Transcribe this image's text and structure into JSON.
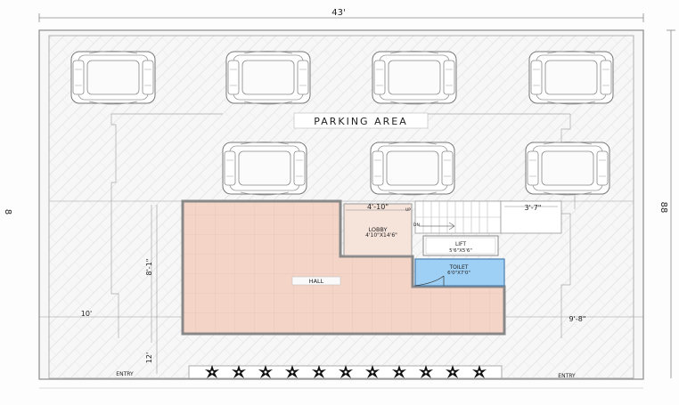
{
  "dimensions": {
    "top_width": "43'",
    "left_height": "8",
    "right_height": "88",
    "left_setback": "10'",
    "right_setback": "9'-8\"",
    "hall_height_upper": "8'-1\"",
    "hall_height_lower": "12'",
    "lobby_width": "4'-10\"",
    "stair_width": "3'-7\""
  },
  "labels": {
    "parking": "PARKING AREA",
    "lobby_name": "LOBBY",
    "lobby_size": "4'10\"X14'6\"",
    "lift_name": "LIFT",
    "lift_size": "5'6\"X5'6\"",
    "toilet_name": "TOILET",
    "toilet_size": "6'0\"X7'0\"",
    "hall": "HALL",
    "entry_left": "ENTRY",
    "entry_right": "ENTRY",
    "stair_up": "UP",
    "stair_dn": "DN"
  },
  "colors": {
    "hall_fill": "#f3d4c6",
    "lobby_fill": "#f6e3da",
    "toilet_fill": "#9ed0f5",
    "wall": "#9a9a9a",
    "line": "#6f6f6f"
  },
  "icons": {
    "car": "car-icon",
    "plant": "plant-icon"
  }
}
